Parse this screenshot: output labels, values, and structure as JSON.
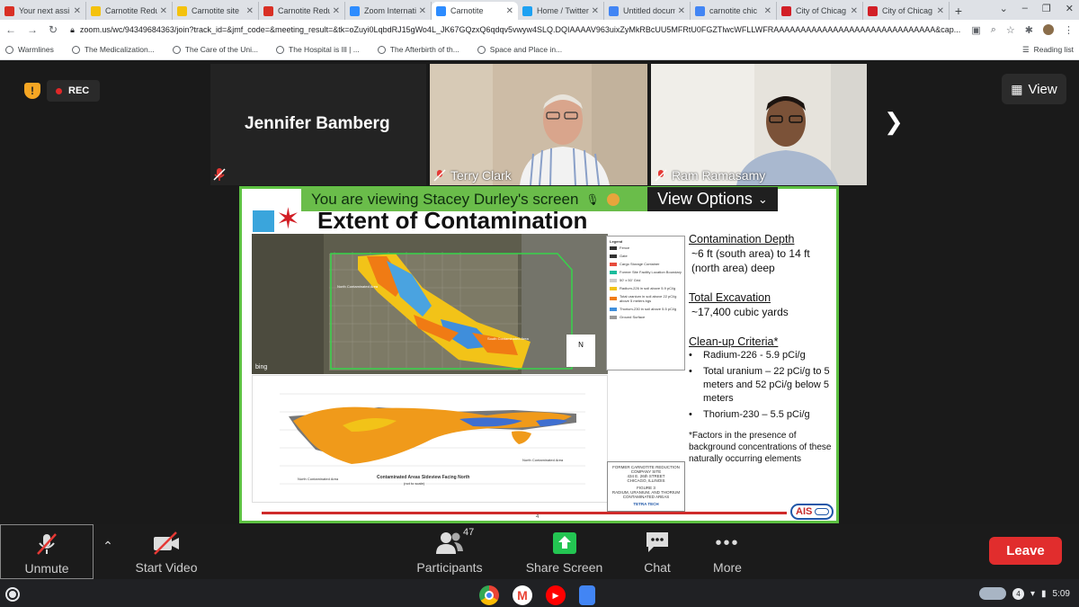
{
  "browser": {
    "tabs": [
      {
        "title": "Your next assi",
        "icon": "gmail-icon",
        "color": "#d93025"
      },
      {
        "title": "Carnotite Redu",
        "icon": "document-icon",
        "color": "#f4c20d"
      },
      {
        "title": "Carnotite site",
        "icon": "document-icon",
        "color": "#f4c20d"
      },
      {
        "title": "Carnotite Redu",
        "icon": "gmail-icon",
        "color": "#d93025"
      },
      {
        "title": "Zoom Internati",
        "icon": "zoom-icon",
        "color": "#2d8cff"
      },
      {
        "title": "Carnotite",
        "icon": "zoom-icon",
        "color": "#2d8cff"
      },
      {
        "title": "Home / Twitter",
        "icon": "twitter-icon",
        "color": "#1da1f2"
      },
      {
        "title": "Untitled docum",
        "icon": "docs-icon",
        "color": "#4285f4"
      },
      {
        "title": "carnotite chic",
        "icon": "google-icon",
        "color": "#4285f4"
      },
      {
        "title": "City of Chicag",
        "icon": "chicago-star-icon",
        "color": "#d21f26"
      },
      {
        "title": "City of Chicag",
        "icon": "chicago-star-icon",
        "color": "#d21f26"
      }
    ],
    "new_tab": "+",
    "url": "zoom.us/wc/94349684363/join?track_id=&jmf_code=&meeting_result=&tk=oZuyi0LqbdRJ15gWo4L_JK67GQzxQ6qdqv5vwyw4SLQ.DQIAAAAV963uixZyMkRBcUU5MFRtU0FGZTlwcWFLLWFRAAAAAAAAAAAAAAAAAAAAAAAAAAAAAA&cap...",
    "bookmarks": [
      "Warmlines",
      "The Medicalization...",
      "The Care of the Uni...",
      "The Hospital is Ill | ...",
      "The Afterbirth of th...",
      "Space and Place in..."
    ],
    "reading_list": "Reading list"
  },
  "meeting": {
    "rec_label": "REC",
    "view_label": "View",
    "participants": [
      {
        "name": "Jennifer Bamberg"
      },
      {
        "name": "Terry Clark"
      },
      {
        "name": "Ram Ramasamy"
      }
    ],
    "viewing_banner": "You are viewing Stacey Durley's screen",
    "view_options": "View Options"
  },
  "slide": {
    "title": "Extent of Contamination",
    "depth_heading": "Contamination Depth",
    "depth_text": "~6 ft (south area) to 14 ft (north area) deep",
    "excavation_heading": "Total Excavation",
    "excavation_text": "~17,400 cubic yards",
    "criteria_heading": "Clean-up Criteria*",
    "criteria": [
      "Radium-226 - 5.9 pCi/g",
      "Total uranium – 22 pCi/g to 5 meters and 52 pCi/g below 5 meters",
      "Thorium-230 – 5.5 pCi/g"
    ],
    "footnote": "*Factors in the presence of background concentrations of these naturally occurring elements",
    "map_labels": {
      "north_area": "North Contaminated Area",
      "south_area": "South Contaminated Area",
      "bing": "bing"
    },
    "section_title": "Contaminated Areas Sideview Facing North",
    "section_subtitle": "(not to scale)",
    "section_north": "North Contaminated Area",
    "section_south": "North Contaminated Area",
    "legend_title": "Legend",
    "legend_items": [
      "Fence",
      "Gate",
      "Cargo Storage Container",
      "Former Site Facility Location Boundary",
      "50' x 50' Grid",
      "Radium-226 in soil above 5.9 pCi/g",
      "Total uranium in soil above 22 pCi/g above 5 meters bgs",
      "Thorium-230 in soil above 5.5 pCi/g",
      "Ground Surface"
    ],
    "titleblock": [
      "FORMER CARNOTITE REDUCTION",
      "COMPANY SITE",
      "434 E. 26th STREET",
      "CHICAGO, ILLINOIS",
      "FIGURE 3",
      "RADIUM, URANIUM, AND THORIUM",
      "CONTAMINATED AREAS",
      "TETRA TECH"
    ],
    "page_number": "4",
    "ais_logo": "AIS"
  },
  "toolbar": {
    "unmute": "Unmute",
    "start_video": "Start Video",
    "participants": "Participants",
    "participants_count": "47",
    "share_screen": "Share Screen",
    "chat": "Chat",
    "more": "More",
    "leave": "Leave"
  },
  "shelf": {
    "notifications": "4",
    "time": "5:09"
  }
}
